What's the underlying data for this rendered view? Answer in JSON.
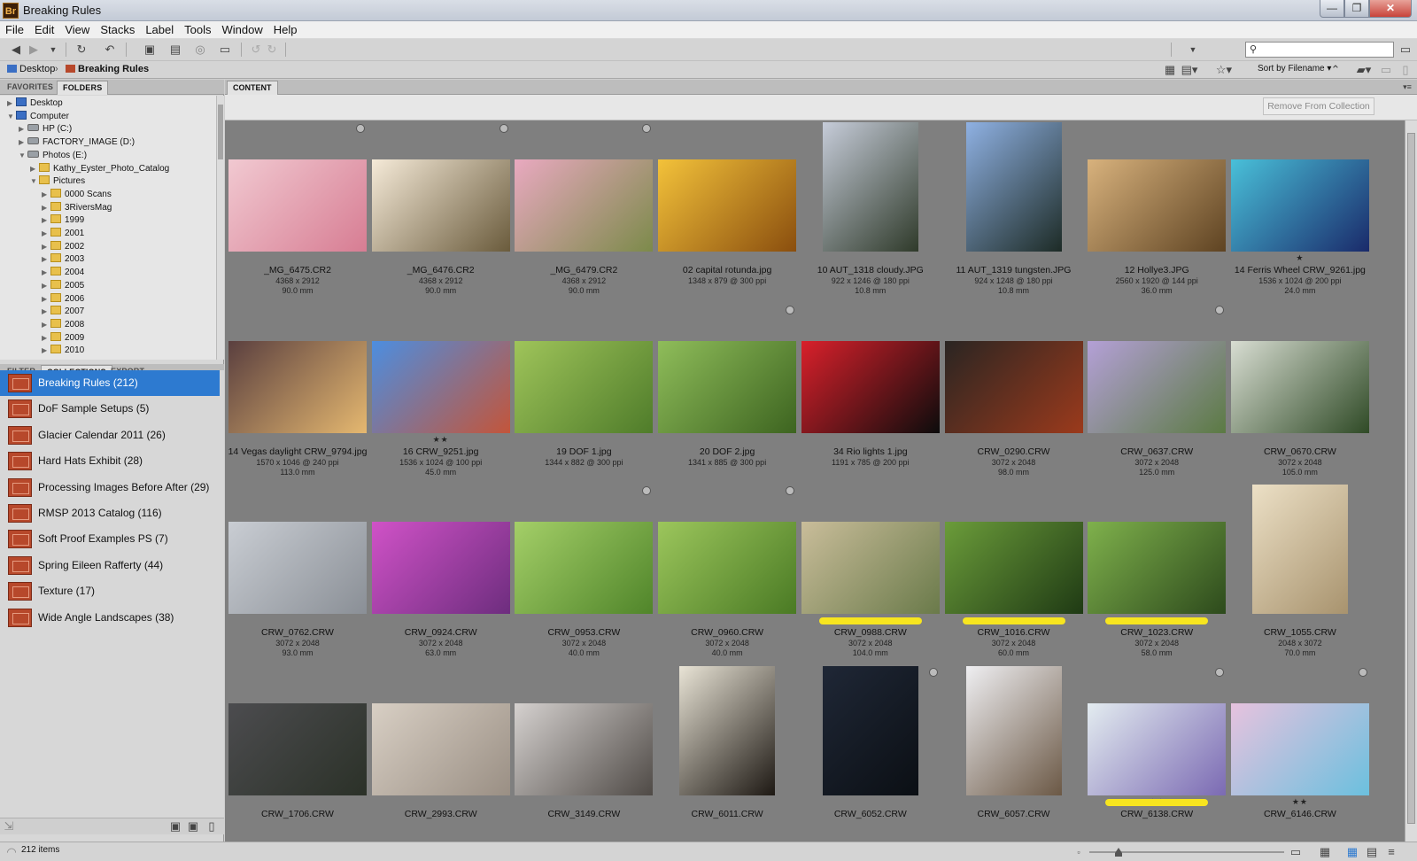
{
  "window": {
    "app_icon": "Br",
    "title": "Breaking Rules",
    "minimize": "—",
    "maximize": "❐",
    "close": "✕"
  },
  "menu": [
    "File",
    "Edit",
    "View",
    "Stacks",
    "Label",
    "Tools",
    "Window",
    "Help"
  ],
  "toolbar": {
    "search_placeholder": ""
  },
  "breadcrumb": {
    "desktop": "Desktop",
    "sep": "›",
    "current": "Breaking Rules",
    "sort_label": "Sort by Filename"
  },
  "left_tabs": {
    "favorites": "FAVORITES",
    "folders": "FOLDERS",
    "filter": "FILTER",
    "collections": "COLLECTIONS",
    "export": "EXPORT"
  },
  "folder_tree": [
    {
      "label": "Desktop",
      "depth": 0,
      "icon": "pc-icon",
      "arrow": "▶"
    },
    {
      "label": "Computer",
      "depth": 0,
      "icon": "pc-icon",
      "arrow": "▼"
    },
    {
      "label": "HP (C:)",
      "depth": 1,
      "icon": "drive-icon",
      "arrow": "▶"
    },
    {
      "label": "FACTORY_IMAGE (D:)",
      "depth": 1,
      "icon": "drive-icon",
      "arrow": "▶"
    },
    {
      "label": "Photos (E:)",
      "depth": 1,
      "icon": "drive-icon",
      "arrow": "▼"
    },
    {
      "label": "Kathy_Eyster_Photo_Catalog",
      "depth": 2,
      "icon": "folder-icon",
      "arrow": "▶"
    },
    {
      "label": "Pictures",
      "depth": 2,
      "icon": "folder-icon",
      "arrow": "▼"
    },
    {
      "label": "0000 Scans",
      "depth": 3,
      "icon": "folder-icon",
      "arrow": "▶"
    },
    {
      "label": "3RiversMag",
      "depth": 3,
      "icon": "folder-icon",
      "arrow": "▶"
    },
    {
      "label": "1999",
      "depth": 3,
      "icon": "folder-icon",
      "arrow": "▶"
    },
    {
      "label": "2001",
      "depth": 3,
      "icon": "folder-icon",
      "arrow": "▶"
    },
    {
      "label": "2002",
      "depth": 3,
      "icon": "folder-icon",
      "arrow": "▶"
    },
    {
      "label": "2003",
      "depth": 3,
      "icon": "folder-icon",
      "arrow": "▶"
    },
    {
      "label": "2004",
      "depth": 3,
      "icon": "folder-icon",
      "arrow": "▶"
    },
    {
      "label": "2005",
      "depth": 3,
      "icon": "folder-icon",
      "arrow": "▶"
    },
    {
      "label": "2006",
      "depth": 3,
      "icon": "folder-icon",
      "arrow": "▶"
    },
    {
      "label": "2007",
      "depth": 3,
      "icon": "folder-icon",
      "arrow": "▶"
    },
    {
      "label": "2008",
      "depth": 3,
      "icon": "folder-icon",
      "arrow": "▶"
    },
    {
      "label": "2009",
      "depth": 3,
      "icon": "folder-icon",
      "arrow": "▶"
    },
    {
      "label": "2010",
      "depth": 3,
      "icon": "folder-icon",
      "arrow": "▶"
    }
  ],
  "collections": [
    {
      "label": "Breaking Rules (212)",
      "selected": true
    },
    {
      "label": "DoF Sample Setups (5)",
      "selected": false
    },
    {
      "label": "Glacier Calendar 2011 (26)",
      "selected": false
    },
    {
      "label": "Hard Hats Exhibit (28)",
      "selected": false
    },
    {
      "label": "Processing Images Before After (29)",
      "selected": false
    },
    {
      "label": "RMSP 2013 Catalog  (116)",
      "selected": false
    },
    {
      "label": "Soft Proof Examples PS (7)",
      "selected": false
    },
    {
      "label": "Spring Eileen Rafferty (44)",
      "selected": false
    },
    {
      "label": "Texture (17)",
      "selected": false
    },
    {
      "label": "Wide Angle Landscapes (38)",
      "selected": false
    }
  ],
  "content": {
    "tab": "CONTENT",
    "remove_button": "Remove From Collection"
  },
  "thumbnails": [
    {
      "name": "_MG_6475.CR2",
      "dims": "4368 x 2912",
      "focal": "90.0 mm",
      "orient": "land",
      "colors": [
        "#f1c9d1",
        "#d77d93"
      ],
      "stack": true
    },
    {
      "name": "_MG_6476.CR2",
      "dims": "4368 x 2912",
      "focal": "90.0 mm",
      "orient": "land",
      "colors": [
        "#f5ead8",
        "#6a5b3c"
      ],
      "stack": true
    },
    {
      "name": "_MG_6479.CR2",
      "dims": "4368 x 2912",
      "focal": "90.0 mm",
      "orient": "land",
      "colors": [
        "#e9a9c0",
        "#7c8a4a"
      ],
      "stack": true
    },
    {
      "name": "02 capital rotunda.jpg",
      "dims": "1348 x 879 @ 300 ppi",
      "focal": "",
      "orient": "land",
      "colors": [
        "#f3c23a",
        "#8a4e0e"
      ]
    },
    {
      "name": "10 AUT_1318 cloudy.JPG",
      "dims": "922 x 1246 @ 180 ppi",
      "focal": "10.8 mm",
      "orient": "port",
      "colors": [
        "#c6ccd9",
        "#2f3a2a"
      ]
    },
    {
      "name": "11 AUT_1319 tungsten.JPG",
      "dims": "924 x 1248 @ 180 ppi",
      "focal": "10.8 mm",
      "orient": "port",
      "colors": [
        "#8fb1e3",
        "#1d2b26"
      ]
    },
    {
      "name": "12 Hollye3.JPG",
      "dims": "2560 x 1920 @ 144 ppi",
      "focal": "36.0 mm",
      "orient": "land",
      "colors": [
        "#d8b27d",
        "#5e4322"
      ]
    },
    {
      "name": "14 Ferris Wheel CRW_9261.jpg",
      "dims": "1536 x 1024 @ 200 ppi",
      "focal": "24.0 mm",
      "orient": "land",
      "colors": [
        "#49c0d9",
        "#1a2a6a"
      ],
      "stars": "★"
    },
    {
      "name": "14 Vegas daylight CRW_9794.jpg",
      "dims": "1570 x 1046 @ 240 ppi",
      "focal": "113.0 mm",
      "orient": "land",
      "colors": [
        "#5a3f3f",
        "#e5b870"
      ]
    },
    {
      "name": "16 CRW_9251.jpg",
      "dims": "1536 x 1024 @ 100 ppi",
      "focal": "45.0 mm",
      "orient": "land",
      "colors": [
        "#4c8ee0",
        "#c3553a"
      ],
      "stars": "★★"
    },
    {
      "name": "19 DOF 1.jpg",
      "dims": "1344 x 882 @ 300 ppi",
      "focal": "",
      "orient": "land",
      "colors": [
        "#9fc45a",
        "#4f7c2a"
      ]
    },
    {
      "name": "20 DOF 2.jpg",
      "dims": "1341 x 885 @ 300 ppi",
      "focal": "",
      "orient": "land",
      "colors": [
        "#8fbd5a",
        "#3d6420"
      ],
      "stack": true
    },
    {
      "name": "34 Rio lights 1.jpg",
      "dims": "1191 x 785 @ 200 ppi",
      "focal": "",
      "orient": "land",
      "colors": [
        "#d9202b",
        "#0c0c0c"
      ]
    },
    {
      "name": "CRW_0290.CRW",
      "dims": "3072 x 2048",
      "focal": "98.0 mm",
      "orient": "land",
      "colors": [
        "#2a2522",
        "#9b3a1c"
      ]
    },
    {
      "name": "CRW_0637.CRW",
      "dims": "3072 x 2048",
      "focal": "125.0 mm",
      "orient": "land",
      "colors": [
        "#b4a0d7",
        "#5b7a43"
      ],
      "stack": true
    },
    {
      "name": "CRW_0670.CRW",
      "dims": "3072 x 2048",
      "focal": "105.0 mm",
      "orient": "land",
      "colors": [
        "#d8ddd2",
        "#2f4a26"
      ]
    },
    {
      "name": "CRW_0762.CRW",
      "dims": "3072 x 2048",
      "focal": "93.0 mm",
      "orient": "land",
      "colors": [
        "#c9cdd3",
        "#8a8f96"
      ]
    },
    {
      "name": "CRW_0924.CRW",
      "dims": "3072 x 2048",
      "focal": "63.0 mm",
      "orient": "land",
      "colors": [
        "#d052c7",
        "#6d2d7e"
      ]
    },
    {
      "name": "CRW_0953.CRW",
      "dims": "3072 x 2048",
      "focal": "40.0 mm",
      "orient": "land",
      "colors": [
        "#a4cf68",
        "#50852a"
      ],
      "stack": true
    },
    {
      "name": "CRW_0960.CRW",
      "dims": "3072 x 2048",
      "focal": "40.0 mm",
      "orient": "land",
      "colors": [
        "#9cc65c",
        "#4a7a24"
      ],
      "stack": true
    },
    {
      "name": "CRW_0988.CRW",
      "dims": "3072 x 2048",
      "focal": "104.0 mm",
      "orient": "land",
      "colors": [
        "#c9bd9a",
        "#6a7a4a"
      ],
      "label": "yellow"
    },
    {
      "name": "CRW_1016.CRW",
      "dims": "3072 x 2048",
      "focal": "60.0 mm",
      "orient": "land",
      "colors": [
        "#6b9c3a",
        "#1f3a14"
      ],
      "label": "yellow"
    },
    {
      "name": "CRW_1023.CRW",
      "dims": "3072 x 2048",
      "focal": "58.0 mm",
      "orient": "land",
      "colors": [
        "#7fb14c",
        "#2d4a1c"
      ],
      "label": "yellow"
    },
    {
      "name": "CRW_1055.CRW",
      "dims": "2048 x 3072",
      "focal": "70.0 mm",
      "orient": "port",
      "colors": [
        "#ece0c6",
        "#a8936e"
      ]
    },
    {
      "name": "CRW_1706.CRW",
      "dims": "",
      "focal": "",
      "orient": "land",
      "colors": [
        "#4c4c4f",
        "#2b3128"
      ]
    },
    {
      "name": "CRW_2993.CRW",
      "dims": "",
      "focal": "",
      "orient": "land",
      "colors": [
        "#d8cfc4",
        "#9a8f84"
      ]
    },
    {
      "name": "CRW_3149.CRW",
      "dims": "",
      "focal": "",
      "orient": "land",
      "colors": [
        "#d5d1cf",
        "#4f4a46"
      ]
    },
    {
      "name": "CRW_6011.CRW",
      "dims": "",
      "focal": "",
      "orient": "port",
      "colors": [
        "#e9e4d6",
        "#1d1813"
      ]
    },
    {
      "name": "CRW_6052.CRW",
      "dims": "",
      "focal": "",
      "orient": "port",
      "colors": [
        "#1f2736",
        "#0b0f14"
      ],
      "stack": true
    },
    {
      "name": "CRW_6057.CRW",
      "dims": "",
      "focal": "",
      "orient": "port",
      "colors": [
        "#efeff2",
        "#6b5845"
      ]
    },
    {
      "name": "CRW_6138.CRW",
      "dims": "",
      "focal": "",
      "orient": "land",
      "colors": [
        "#e3ecf0",
        "#7b6ab3"
      ],
      "stars": "★★",
      "label": "yellow",
      "stack": true
    },
    {
      "name": "CRW_6146.CRW",
      "dims": "",
      "focal": "",
      "orient": "land",
      "colors": [
        "#e7c2de",
        "#6bc0de"
      ],
      "stars": "★★",
      "stack": true
    }
  ],
  "status": {
    "item_count": "212 items",
    "zoom_level": 0.15
  }
}
